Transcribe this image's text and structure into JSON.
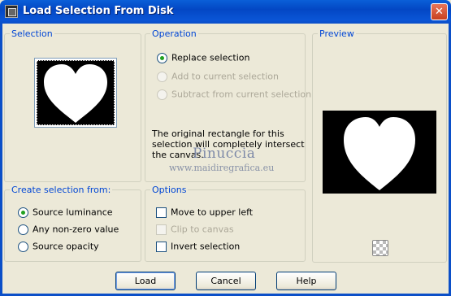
{
  "window": {
    "title": "Load Selection From Disk",
    "close_glyph": "✕"
  },
  "selection_group": {
    "legend": "Selection"
  },
  "operation_group": {
    "legend": "Operation",
    "options": [
      {
        "label": "Replace selection",
        "selected": true,
        "enabled": true
      },
      {
        "label": "Add to current selection",
        "selected": false,
        "enabled": false
      },
      {
        "label": "Subtract from current selection",
        "selected": false,
        "enabled": false
      }
    ],
    "info_text": "The original rectangle for this selection will completely intersect the canvas."
  },
  "watermark": {
    "name": "Pinuccia",
    "url": "www.maidiregrafica.eu"
  },
  "preview_group": {
    "legend": "Preview",
    "transparency_icon": "checkerboard-icon"
  },
  "create_group": {
    "legend": "Create selection from:",
    "options": [
      {
        "label": "Source luminance",
        "selected": true
      },
      {
        "label": "Any non-zero value",
        "selected": false
      },
      {
        "label": "Source opacity",
        "selected": false
      }
    ]
  },
  "options_group": {
    "legend": "Options",
    "items": [
      {
        "label": "Move to upper left",
        "checked": false,
        "enabled": true
      },
      {
        "label": "Clip to canvas",
        "checked": false,
        "enabled": false
      },
      {
        "label": "Invert selection",
        "checked": false,
        "enabled": true
      }
    ]
  },
  "buttons": {
    "load": "Load",
    "cancel": "Cancel",
    "help": "Help"
  }
}
